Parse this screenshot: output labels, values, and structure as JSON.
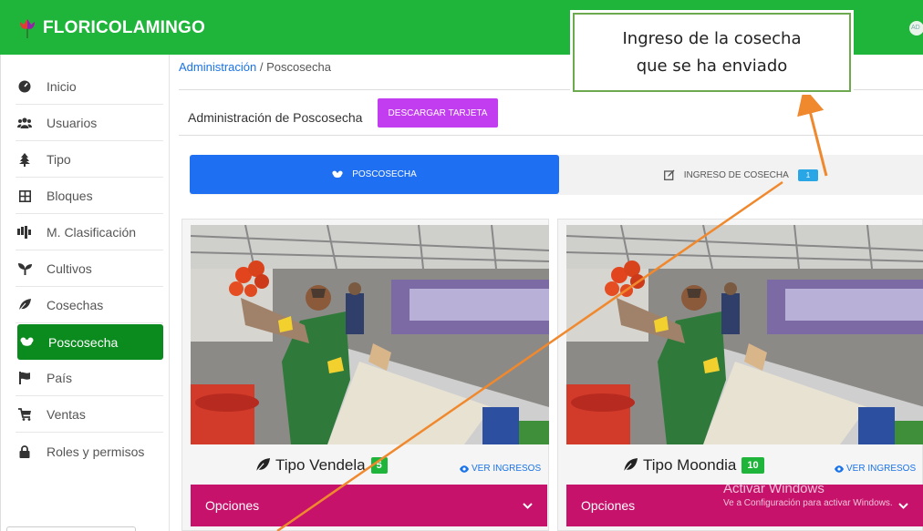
{
  "app": {
    "brand": "FLORICOLAMINGO",
    "avatar_text": "AD"
  },
  "sidebar": {
    "items": [
      {
        "label": "Inicio",
        "icon": "dashboard-icon"
      },
      {
        "label": "Usuarios",
        "icon": "users-icon"
      },
      {
        "label": "Tipo",
        "icon": "tree-icon"
      },
      {
        "label": "Bloques",
        "icon": "grid-icon"
      },
      {
        "label": "M. Clasificación",
        "icon": "classification-icon"
      },
      {
        "label": "Cultivos",
        "icon": "seedling-icon"
      },
      {
        "label": "Cosechas",
        "icon": "leaf-icon"
      },
      {
        "label": "Poscosecha",
        "icon": "flower-icon",
        "active": true
      },
      {
        "label": "País",
        "icon": "flag-icon"
      },
      {
        "label": "Ventas",
        "icon": "cart-icon"
      },
      {
        "label": "Roles y permisos",
        "icon": "lock-icon"
      }
    ]
  },
  "breadcrumb": {
    "root": "Administración",
    "separator": "/",
    "current": "Poscosecha"
  },
  "panel": {
    "title": "Administración de Poscosecha",
    "download_label": "DESCARGAR TARJETA"
  },
  "tabs": [
    {
      "label": "POSCOSECHA",
      "icon": "flower-icon",
      "active": true
    },
    {
      "label": "INGRESO DE COSECHA",
      "icon": "edit-icon",
      "badge": "1"
    }
  ],
  "cards": [
    {
      "title": "Tipo Vendela",
      "count": "5",
      "link": "VER INGRESOS",
      "options_label": "Opciones"
    },
    {
      "title": "Tipo Moondia",
      "count": "10",
      "link": "VER INGRESOS",
      "options_label": "Opciones"
    }
  ],
  "callout": {
    "line1": "Ingreso de la cosecha",
    "line2": "que se ha enviado"
  },
  "watermark": {
    "line1": "Activar Windows",
    "line2": "Ve a Configuración para activar Windows."
  },
  "colors": {
    "topbar": "#1fb53a",
    "sidebar_active": "#0b8a1e",
    "tab_active": "#1f6ff2",
    "download_button": "#c23cf0",
    "options_bar": "#c6126b",
    "count_badge": "#1fb53a",
    "callout_border": "#6da94f",
    "arrow": "#f0892e"
  }
}
